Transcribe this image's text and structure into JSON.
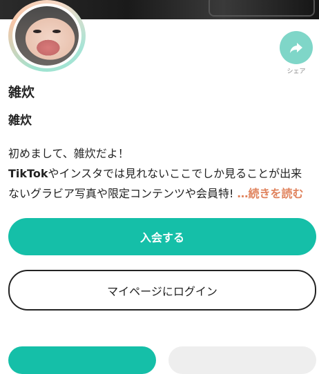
{
  "profile": {
    "share_label": "シェア",
    "display_name": "雑炊",
    "username": "雑炊",
    "bio": {
      "line1": "初めまして、雑炊だよ！",
      "line2_brand": "TikTok",
      "line2_rest": "やインスタでは見れないここでしか見ることが出来",
      "line3": "ないグラビア写真や限定コンテンツや会員特",
      "line3_tail": "!",
      "read_more": "…続きを読む"
    }
  },
  "actions": {
    "join_label": "入会する",
    "login_label": "マイページにログイン"
  },
  "colors": {
    "accent": "#15bfa8",
    "share_button": "#7fd6c8",
    "read_more": "#e0835d"
  },
  "icons": {
    "share": "share-arrow-icon"
  }
}
